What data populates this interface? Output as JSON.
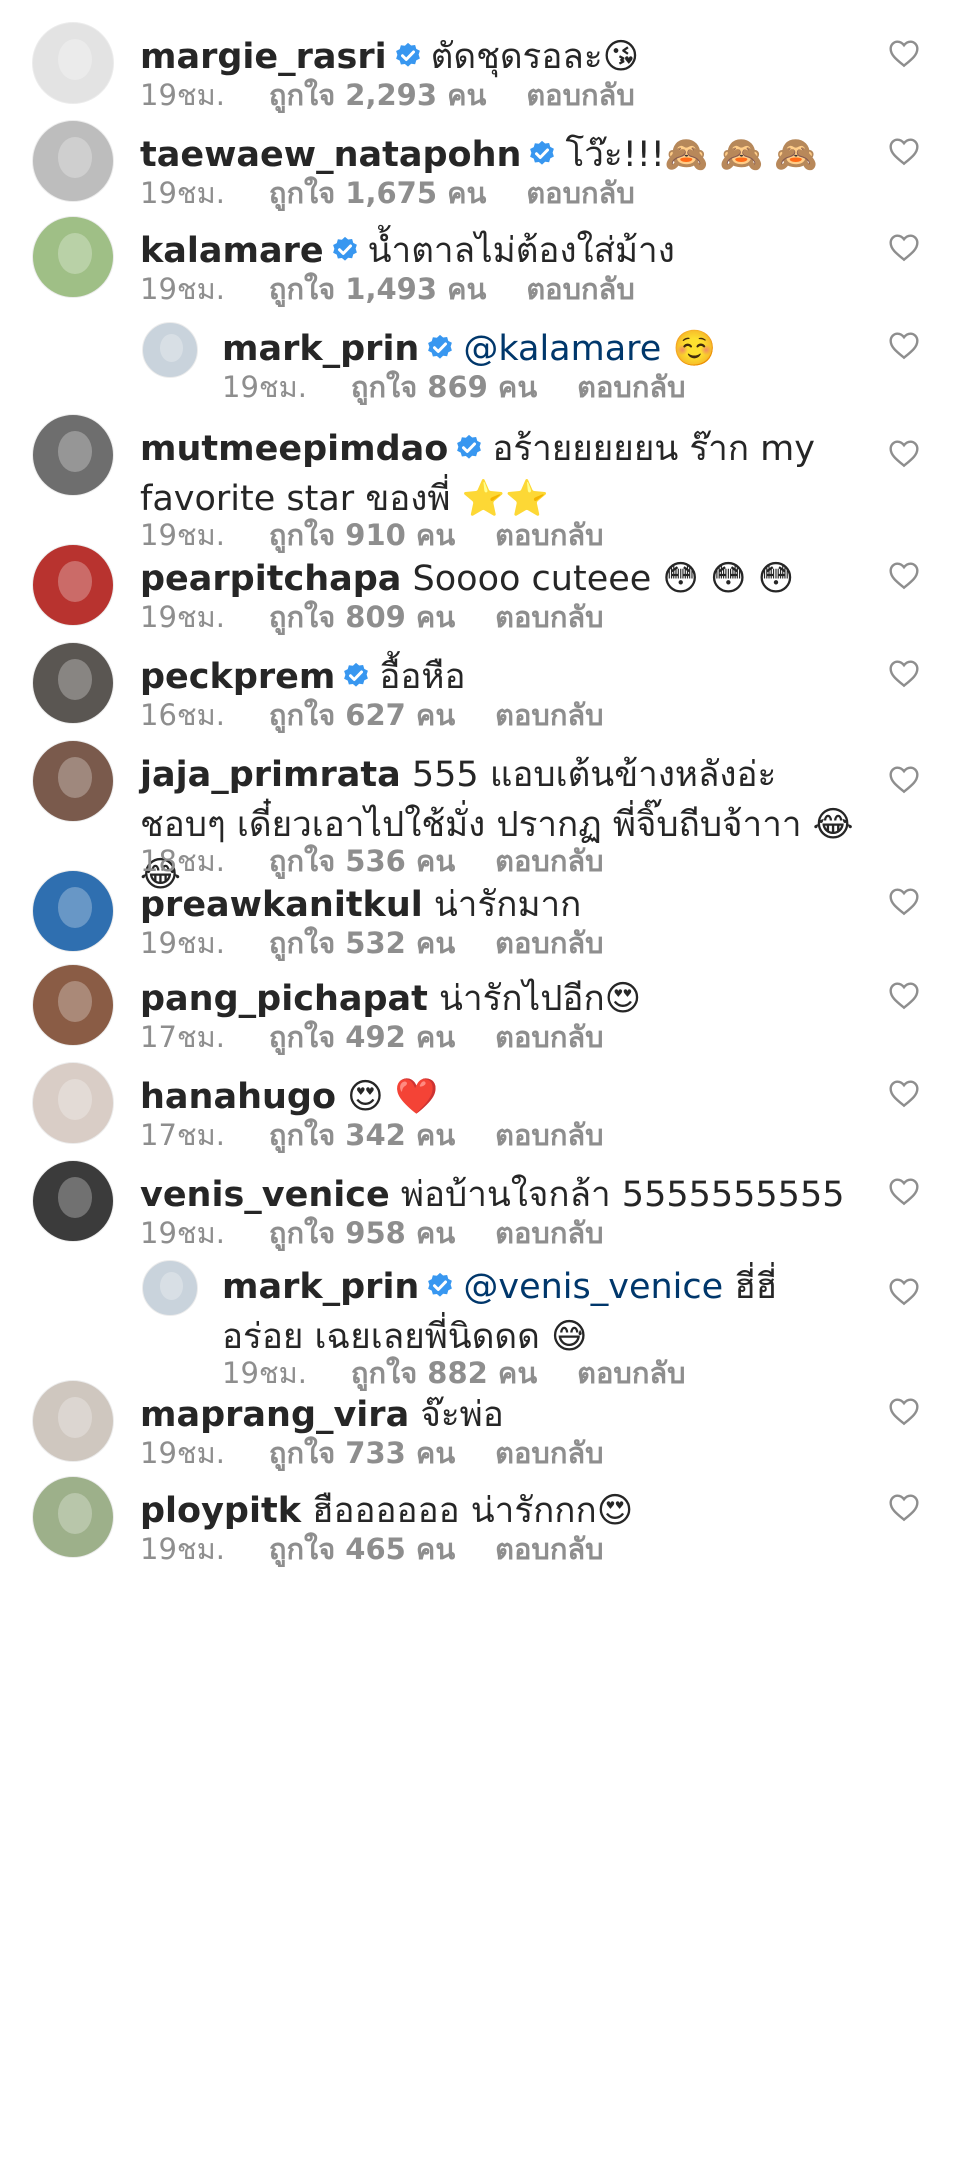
{
  "comments": [
    {
      "username": "margie_rasri",
      "verified": true,
      "mention": "",
      "text": "ตัดชุดรอละ😘",
      "time": "19ชม.",
      "likes": "ถูกใจ 2,293 คน",
      "reply": "ตอบกลับ",
      "reply_comment": false,
      "avatar_color": "#e3e3e3"
    },
    {
      "username": "taewaew_natapohn",
      "verified": true,
      "mention": "",
      "text": "โว๊ะ!!!🙈 🙈 🙈",
      "time": "19ชม.",
      "likes": "ถูกใจ 1,675 คน",
      "reply": "ตอบกลับ",
      "reply_comment": false,
      "avatar_color": "#bdbdbd"
    },
    {
      "username": "kalamare",
      "verified": true,
      "mention": "",
      "text": "น้ำตาลไม่ต้องใส่ม้าง",
      "time": "19ชม.",
      "likes": "ถูกใจ 1,493 คน",
      "reply": "ตอบกลับ",
      "reply_comment": false,
      "avatar_color": "#9fbf86"
    },
    {
      "username": "mark_prin",
      "verified": true,
      "mention": "@kalamare",
      "text": "☺️",
      "time": "19ชม.",
      "likes": "ถูกใจ 869 คน",
      "reply": "ตอบกลับ",
      "reply_comment": true,
      "avatar_color": "#c9d3dc"
    },
    {
      "username": "mutmeepimdao",
      "verified": true,
      "mention": "",
      "text": "อร้ายยยยยน ร๊าก my favorite star ของพี่ ⭐️⭐️",
      "time": "19ชม.",
      "likes": "ถูกใจ 910 คน",
      "reply": "ตอบกลับ",
      "reply_comment": false,
      "avatar_color": "#6e6e6e"
    },
    {
      "username": "pearpitchapa",
      "verified": false,
      "mention": "",
      "text": "Soooo cuteee 😳 😳 😳",
      "time": "19ชม.",
      "likes": "ถูกใจ 809 คน",
      "reply": "ตอบกลับ",
      "reply_comment": false,
      "avatar_color": "#b8332f"
    },
    {
      "username": "peckprem",
      "verified": true,
      "mention": "",
      "text": "อื้อหือ",
      "time": "16ชม.",
      "likes": "ถูกใจ 627 คน",
      "reply": "ตอบกลับ",
      "reply_comment": false,
      "avatar_color": "#5a5652"
    },
    {
      "username": "jaja_primrata",
      "verified": false,
      "mention": "",
      "text": "555 แอบเต้นข้างหลังอ่ะ ชอบๆ เดี๋ยวเอาไปใช้มั่ง ปรากฏ พี่จิ๊บถีบจ้าาา 😂😂",
      "time": "18ชม.",
      "likes": "ถูกใจ 536 คน",
      "reply": "ตอบกลับ",
      "reply_comment": false,
      "avatar_color": "#7a5a4c"
    },
    {
      "username": "preawkanitkul",
      "verified": false,
      "mention": "",
      "text": "น่ารักมาก",
      "time": "19ชม.",
      "likes": "ถูกใจ 532 คน",
      "reply": "ตอบกลับ",
      "reply_comment": false,
      "avatar_color": "#2f6fb0"
    },
    {
      "username": "pang_pichapat",
      "verified": false,
      "mention": "",
      "text": "น่ารักไปอีก😍",
      "time": "17ชม.",
      "likes": "ถูกใจ 492 คน",
      "reply": "ตอบกลับ",
      "reply_comment": false,
      "avatar_color": "#8a5c45"
    },
    {
      "username": "hanahugo",
      "verified": false,
      "mention": "",
      "text": "😍 ❤️",
      "time": "17ชม.",
      "likes": "ถูกใจ 342 คน",
      "reply": "ตอบกลับ",
      "reply_comment": false,
      "avatar_color": "#d9cdc6"
    },
    {
      "username": "venis_venice",
      "verified": false,
      "mention": "",
      "text": "พ่อบ้านใจกล้า 5555555555",
      "time": "19ชม.",
      "likes": "ถูกใจ 958 คน",
      "reply": "ตอบกลับ",
      "reply_comment": false,
      "avatar_color": "#3b3b3b"
    },
    {
      "username": "mark_prin",
      "verified": true,
      "mention": "@venis_venice",
      "text": "ฮี่ฮี่ อร่อย เฉยเลยพี่นิดดด 😅",
      "time": "19ชม.",
      "likes": "ถูกใจ 882 คน",
      "reply": "ตอบกลับ",
      "reply_comment": true,
      "avatar_color": "#c9d3dc"
    },
    {
      "username": "maprang_vira",
      "verified": false,
      "mention": "",
      "text": "จ๊ะพ่อ",
      "time": "19ชม.",
      "likes": "ถูกใจ 733 คน",
      "reply": "ตอบกลับ",
      "reply_comment": false,
      "avatar_color": "#cfc7bf"
    },
    {
      "username": "ploypitk",
      "verified": false,
      "mention": "",
      "text": "ฮืออออออ น่ารักกก😍",
      "time": "19ชม.",
      "likes": "ถูกใจ 465 คน",
      "reply": "ตอบกลับ",
      "reply_comment": false,
      "avatar_color": "#9db08a"
    }
  ],
  "icons": {
    "verified_badge": "verified-badge-icon",
    "like": "heart-outline-icon"
  },
  "colors": {
    "text": "#262626",
    "meta": "#8e8e8e",
    "mention": "#00376b",
    "verified": "#3897f0",
    "heart_stroke": "#8e8e8e"
  }
}
